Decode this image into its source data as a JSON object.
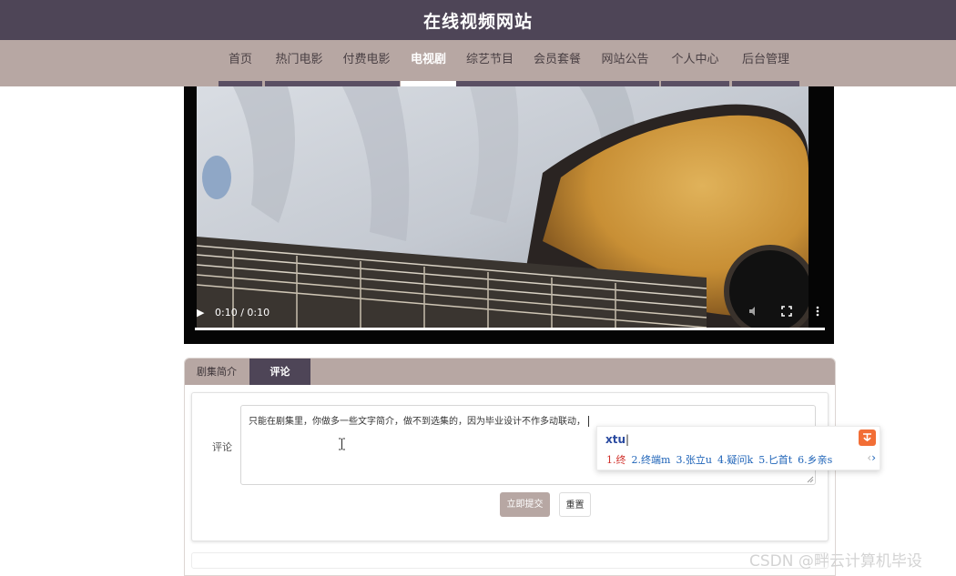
{
  "header": {
    "title": "在线视频网站"
  },
  "nav": {
    "items": [
      {
        "label": "首页"
      },
      {
        "label": "热门电影"
      },
      {
        "label": "付费电影"
      },
      {
        "label": "电视剧",
        "active": true
      },
      {
        "label": "综艺节目"
      },
      {
        "label": "会员套餐"
      },
      {
        "label": "网站公告"
      },
      {
        "label": "个人中心"
      },
      {
        "label": "后台管理"
      }
    ]
  },
  "player": {
    "time": "0:10 / 0:10",
    "progress": 1.0,
    "icons": [
      "play-icon",
      "volume-icon",
      "fullscreen-icon",
      "more-icon"
    ]
  },
  "tabs": {
    "intro_label": "剧集简介",
    "comment_label": "评论",
    "active": "评论"
  },
  "comment_form": {
    "label": "评论",
    "value": "只能在剧集里，你做多一些文字简介，做不到选集的，因为毕业设计不作多动联动，",
    "submit_label": "立即提交",
    "reset_label": "重置"
  },
  "ime": {
    "input": "xtu",
    "candidates": [
      "1.终",
      "2.终端m",
      "3.张立u",
      "4.疑问k",
      "5.匕首t",
      "6.乡亲s"
    ],
    "prev": "‹",
    "next": "›"
  },
  "watermark": "CSDN @畔云计算机毕设",
  "colors": {
    "header_bg": "#4e4557",
    "nav_bg": "#b7a7a3",
    "accent_btn": "#b7a7a3",
    "active_tab": "#4e4557"
  }
}
